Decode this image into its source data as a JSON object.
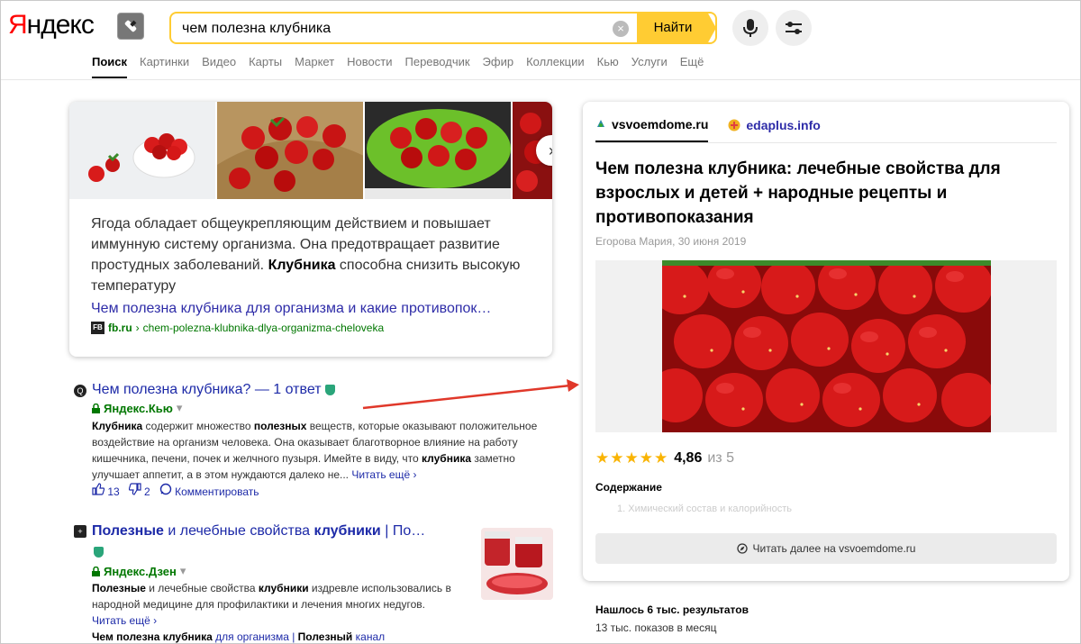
{
  "header": {
    "logo_first": "Я",
    "logo_rest": "ндекс",
    "query": "чем полезна клубника",
    "search_button": "Найти",
    "clear_symbol": "×"
  },
  "tabs": [
    "Поиск",
    "Картинки",
    "Видео",
    "Карты",
    "Маркет",
    "Новости",
    "Переводчик",
    "Эфир",
    "Коллекции",
    "Кью",
    "Услуги",
    "Ещё"
  ],
  "card": {
    "desc_before": "Ягода обладает общеукрепляющим действием и повышает иммунную систему организма. Она предотвращает развитие простудных заболеваний. ",
    "desc_bold": "Клубника",
    "desc_after": " способна снизить высокую температуру",
    "link": "Чем полезна клубника для организма и какие противопок…",
    "src_icon": "FB",
    "src_domain": "fb.ru",
    "src_path": "chem-polezna-klubnika-dlya-organizma-cheloveka",
    "next_symbol": "›"
  },
  "result1": {
    "title": "Чем полезна клубника",
    "title_q": "? — 1 ответ",
    "source": "Яндекс.Кью",
    "snippet_b1": "Клубника",
    "snippet_1": " содержит множество ",
    "snippet_b2": "полезных",
    "snippet_2": " веществ, которые оказывают положительное воздействие на организм человека. Она оказывает благотворное влияние на работу кишечника, печени, почек и желчного пузыря. Имейте в виду, что ",
    "snippet_b3": "клубника",
    "snippet_3": " заметно улучшает аппетит, а в этом нуждаются далеко не...",
    "read_more": "Читать ещё ›",
    "likes": "13",
    "dislikes": "2",
    "comment": "Комментировать"
  },
  "result2": {
    "title_b1": "Полезные",
    "title_mid": " и лечебные свойства ",
    "title_b2": "клубники",
    "title_end": " | По…",
    "source": "Яндекс.Дзен",
    "snippet_b1": "Полезные",
    "snippet_1": " и лечебные свойства ",
    "snippet_b2": "клубники",
    "snippet_2": " издревле использовались в народной медицине для профилактики и лечения многих недугов.",
    "read_more": "Читать ещё ›",
    "sitelink_b": "Чем полезна клубника",
    "sitelink_1": " для организма",
    "sitelink_sep": " | ",
    "sitelink_b2": "Полезный",
    "sitelink_2": " канал"
  },
  "panel": {
    "tab1": "vsvoemdome.ru",
    "tab2": "edaplus.info",
    "title": "Чем полезна клубника: лечебные свойства для взрослых и детей + народные рецепты и противопоказания",
    "author": "Егорова Мария, 30 июня 2019",
    "stars": "★★★★★",
    "rating": "4,86",
    "rating_of": "из 5",
    "contents_label": "Содержание",
    "contents_item": "1. Химический состав и калорийность",
    "read_more": "Читать далее на vsvoemdome.ru"
  },
  "footer": {
    "found": "Нашлось 6 тыс. результатов",
    "shows": "13 тыс. показов в месяц"
  },
  "colors": {
    "accent": "#ffcc33",
    "link": "#1d2aa8",
    "green": "#007700",
    "red": "#ff0000"
  }
}
